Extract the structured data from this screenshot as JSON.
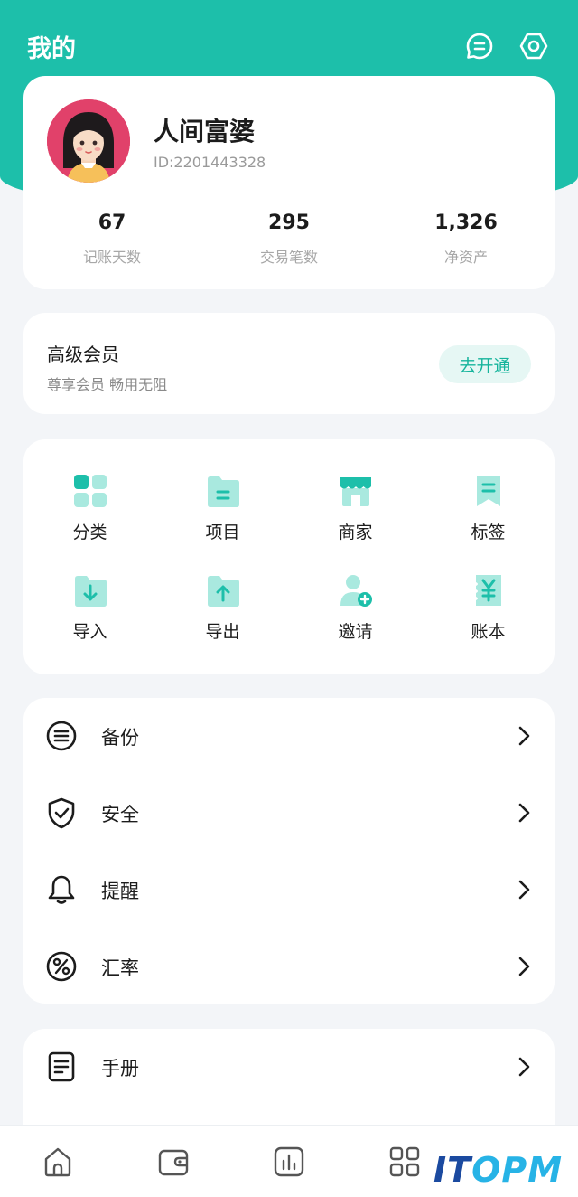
{
  "header": {
    "title": "我的",
    "icons": [
      "message-icon",
      "settings-icon"
    ]
  },
  "profile": {
    "name": "人间富婆",
    "id_text": "ID:2201443328",
    "stats": [
      {
        "value": "67",
        "label": "记账天数"
      },
      {
        "value": "295",
        "label": "交易笔数"
      },
      {
        "value": "1,326",
        "label": "净资产"
      }
    ]
  },
  "vip": {
    "title": "高级会员",
    "subtitle": "尊享会员 畅用无阻",
    "button": "去开通"
  },
  "grid": [
    {
      "label": "分类",
      "icon": "category-icon"
    },
    {
      "label": "项目",
      "icon": "project-folder-icon"
    },
    {
      "label": "商家",
      "icon": "store-icon"
    },
    {
      "label": "标签",
      "icon": "bookmark-tag-icon"
    },
    {
      "label": "导入",
      "icon": "import-folder-icon"
    },
    {
      "label": "导出",
      "icon": "export-folder-icon"
    },
    {
      "label": "邀请",
      "icon": "invite-user-icon"
    },
    {
      "label": "账本",
      "icon": "ledger-yen-icon"
    }
  ],
  "list": [
    {
      "label": "备份",
      "icon": "backup-icon"
    },
    {
      "label": "安全",
      "icon": "shield-check-icon"
    },
    {
      "label": "提醒",
      "icon": "bell-icon"
    },
    {
      "label": "汇率",
      "icon": "percent-icon"
    }
  ],
  "list2": [
    {
      "label": "手册",
      "icon": "manual-icon"
    }
  ],
  "bottom_nav": [
    "home-icon",
    "wallet-icon",
    "chart-icon",
    "apps-icon"
  ],
  "watermark": {
    "part1": "IT",
    "part2": "OPM"
  },
  "colors": {
    "accent": "#1dbfaa",
    "accent_light": "#b2ebe2",
    "background": "#f3f5f8"
  }
}
